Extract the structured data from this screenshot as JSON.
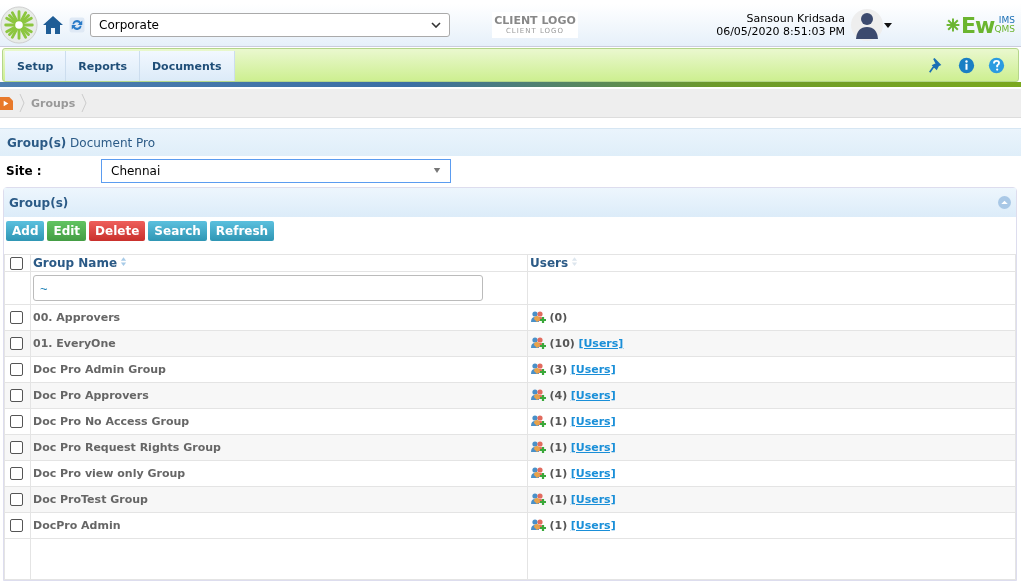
{
  "header": {
    "org_select": {
      "value": "Corporate"
    },
    "client_logo": {
      "title": "CLIENT LOGO",
      "subtitle": "CLIENT LOGO"
    },
    "user": {
      "name": "Sansoun Kridsada",
      "datetime": "06/05/2020 8:51:03 PM"
    },
    "brand": {
      "main": "Ew",
      "top": "IMS",
      "bottom": "QMS"
    }
  },
  "nav": {
    "tabs": [
      {
        "label": "Setup"
      },
      {
        "label": "Reports"
      },
      {
        "label": "Documents"
      }
    ]
  },
  "breadcrumb": {
    "items": [
      "Groups"
    ]
  },
  "page_title": {
    "bold": "Group(s)",
    "rest": "Document Pro"
  },
  "site": {
    "label": "Site :",
    "value": "Chennai"
  },
  "panel": {
    "title": "Group(s)",
    "buttons": [
      {
        "label": "Add",
        "kind": "info"
      },
      {
        "label": "Edit",
        "kind": "success"
      },
      {
        "label": "Delete",
        "kind": "danger"
      },
      {
        "label": "Search",
        "kind": "info"
      },
      {
        "label": "Refresh",
        "kind": "info"
      }
    ],
    "columns": [
      "Group Name",
      "Users"
    ],
    "filter": {
      "value": "~"
    },
    "select_all": {
      "checked": false
    },
    "rows": [
      {
        "name": "00. Approvers",
        "count": "(0)",
        "checked": false
      },
      {
        "name": "01. EveryOne",
        "count": "(10)",
        "link": "[Users]",
        "checked": false
      },
      {
        "name": "Doc Pro Admin Group",
        "count": "(3)",
        "link": "[Users]",
        "checked": false
      },
      {
        "name": "Doc Pro Approvers",
        "count": "(4)",
        "link": "[Users]",
        "checked": false
      },
      {
        "name": "Doc Pro No Access Group",
        "count": "(1)",
        "link": "[Users]",
        "checked": false
      },
      {
        "name": "Doc Pro Request Rights Group",
        "count": "(1)",
        "link": "[Users]",
        "checked": false
      },
      {
        "name": "Doc Pro view only Group",
        "count": "(1)",
        "link": "[Users]",
        "checked": false
      },
      {
        "name": "Doc ProTest Group",
        "count": "(1)",
        "link": "[Users]",
        "checked": false
      },
      {
        "name": "DocPro Admin",
        "count": "(1)",
        "link": "[Users]",
        "checked": false
      }
    ]
  }
}
